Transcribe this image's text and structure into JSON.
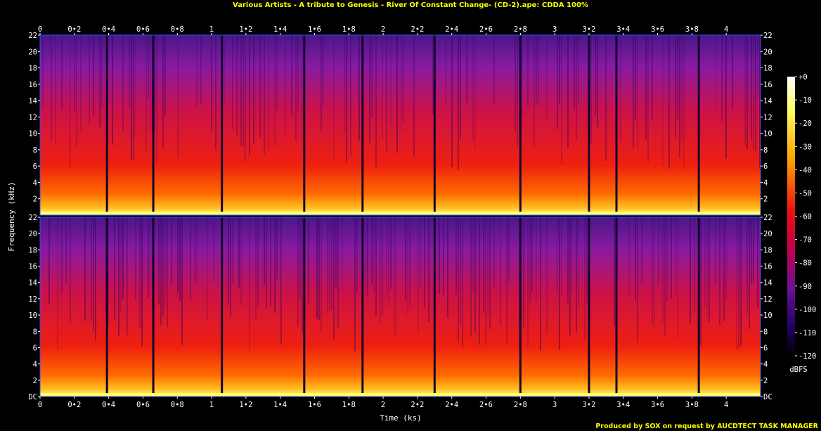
{
  "chart_data": {
    "type": "heatmap",
    "title": "Various Artists - A tribute to Genesis - River Of Constant Change- (CD-2).ape: CDDA 100%",
    "xlabel": "Time (ks)",
    "ylabel": "Frequency (kHz)",
    "xlim": [
      0,
      4.2
    ],
    "ylim": [
      0,
      22
    ],
    "x_ticks": [
      "0",
      "0•2",
      "0•4",
      "0•6",
      "0•8",
      "1",
      "1•2",
      "1•4",
      "1•6",
      "1•8",
      "2",
      "2•2",
      "2•4",
      "2•6",
      "2•8",
      "3",
      "3•2",
      "3•4",
      "3•6",
      "3•8",
      "4"
    ],
    "y_ticks": [
      "DC",
      "2",
      "4",
      "6",
      "8",
      "10",
      "12",
      "14",
      "16",
      "18",
      "20",
      "22"
    ],
    "channels": 2,
    "colorbar": {
      "label": "dBFS",
      "range": [
        -120,
        0
      ],
      "ticks": [
        "+0",
        "-10",
        "-20",
        "-30",
        "-40",
        "-50",
        "-60",
        "-70",
        "-80",
        "-90",
        "-100",
        "-110",
        "-120"
      ]
    },
    "track_boundaries_ks": [
      0.39,
      0.66,
      1.06,
      1.54,
      1.88,
      2.3,
      2.8,
      3.2,
      3.36,
      3.84
    ]
  },
  "footer": "Produced by SOX on request by AUCDTECT TASK MANAGER"
}
